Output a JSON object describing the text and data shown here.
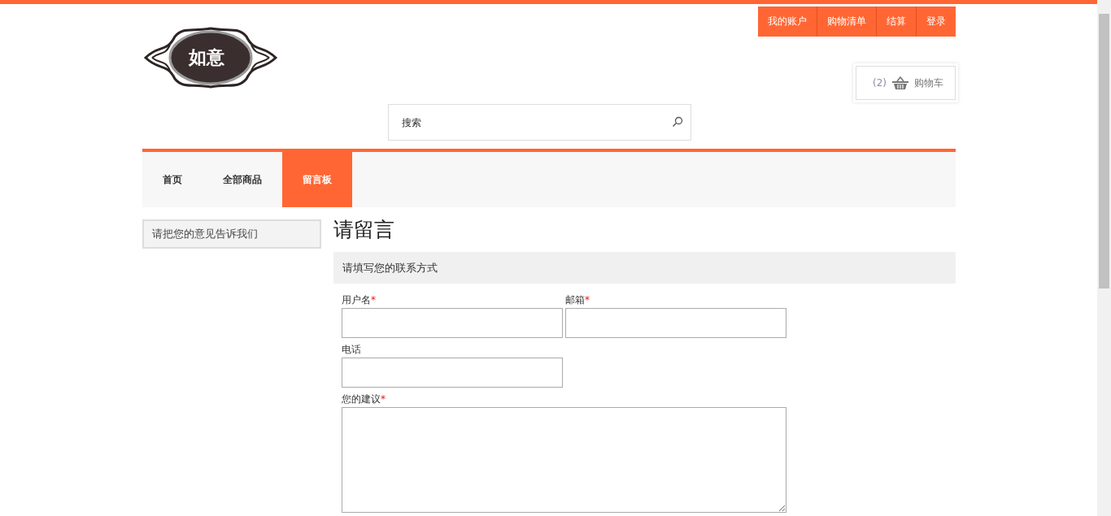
{
  "logo": {
    "text": "如意"
  },
  "top_links": [
    {
      "label": "我的账户"
    },
    {
      "label": "购物清单"
    },
    {
      "label": "结算"
    },
    {
      "label": "登录"
    }
  ],
  "cart": {
    "count": "(2)",
    "label": "购物车"
  },
  "search": {
    "placeholder": "搜索"
  },
  "nav": [
    {
      "label": "首页",
      "selected": false
    },
    {
      "label": "全部商品",
      "selected": false
    },
    {
      "label": "留言板",
      "selected": true
    }
  ],
  "sidebar": {
    "items": [
      {
        "label": "请把您的意见告诉我们"
      }
    ]
  },
  "main": {
    "title": "请留言",
    "section": "请填写您的联系方式",
    "fields": [
      {
        "kind": "input",
        "label": "用户名",
        "mark": "*"
      },
      {
        "kind": "input",
        "label": "邮箱",
        "mark": "*"
      },
      {
        "kind": "input",
        "label": "电话"
      },
      {
        "kind": "textarea",
        "label": "您的建议",
        "mark": "*"
      }
    ]
  }
}
